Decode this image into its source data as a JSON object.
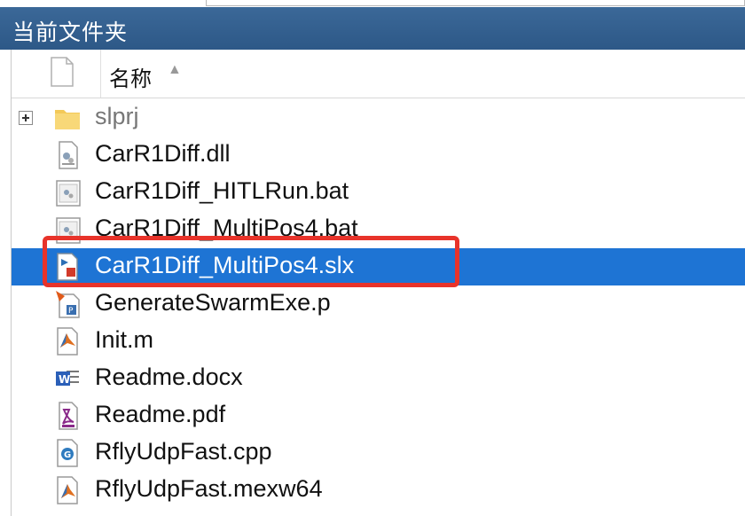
{
  "panel": {
    "title": "当前文件夹"
  },
  "header": {
    "name_column": "名称",
    "sort_indicator": "▲"
  },
  "files": [
    {
      "name": "slprj",
      "icon": "folder-icon"
    },
    {
      "name": "CarR1Diff.dll",
      "icon": "dll-file-icon"
    },
    {
      "name": "CarR1Diff_HITLRun.bat",
      "icon": "bat-file-icon"
    },
    {
      "name": "CarR1Diff_MultiPos4.bat",
      "icon": "bat-file-icon"
    },
    {
      "name": "CarR1Diff_MultiPos4.slx",
      "icon": "simulink-model-icon"
    },
    {
      "name": "GenerateSwarmExe.p",
      "icon": "p-code-file-icon"
    },
    {
      "name": "Init.m",
      "icon": "matlab-script-icon"
    },
    {
      "name": "Readme.docx",
      "icon": "word-document-icon"
    },
    {
      "name": "Readme.pdf",
      "icon": "pdf-file-icon"
    },
    {
      "name": "RflyUdpFast.cpp",
      "icon": "cpp-file-icon"
    },
    {
      "name": "RflyUdpFast.mexw64",
      "icon": "mex-file-icon"
    }
  ],
  "colors": {
    "selection": "#1e74d4",
    "title_bar": "#2d5887",
    "highlight_box": "#e8332a"
  }
}
